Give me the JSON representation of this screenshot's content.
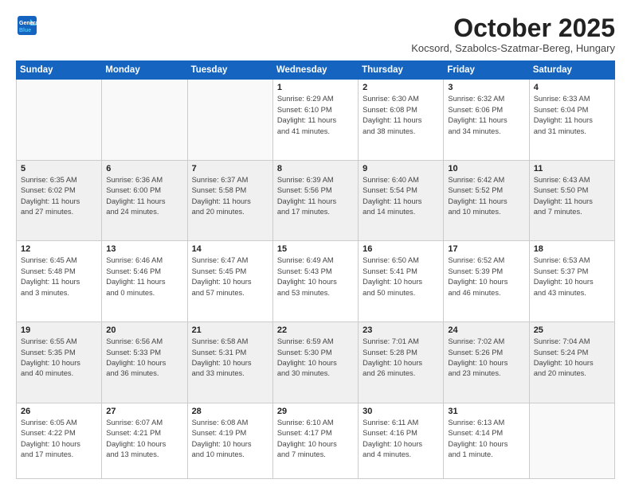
{
  "header": {
    "logo_line1": "General",
    "logo_line2": "Blue",
    "month": "October 2025",
    "location": "Kocsord, Szabolcs-Szatmar-Bereg, Hungary"
  },
  "weekdays": [
    "Sunday",
    "Monday",
    "Tuesday",
    "Wednesday",
    "Thursday",
    "Friday",
    "Saturday"
  ],
  "weeks": [
    [
      {
        "day": "",
        "info": ""
      },
      {
        "day": "",
        "info": ""
      },
      {
        "day": "",
        "info": ""
      },
      {
        "day": "1",
        "info": "Sunrise: 6:29 AM\nSunset: 6:10 PM\nDaylight: 11 hours\nand 41 minutes."
      },
      {
        "day": "2",
        "info": "Sunrise: 6:30 AM\nSunset: 6:08 PM\nDaylight: 11 hours\nand 38 minutes."
      },
      {
        "day": "3",
        "info": "Sunrise: 6:32 AM\nSunset: 6:06 PM\nDaylight: 11 hours\nand 34 minutes."
      },
      {
        "day": "4",
        "info": "Sunrise: 6:33 AM\nSunset: 6:04 PM\nDaylight: 11 hours\nand 31 minutes."
      }
    ],
    [
      {
        "day": "5",
        "info": "Sunrise: 6:35 AM\nSunset: 6:02 PM\nDaylight: 11 hours\nand 27 minutes."
      },
      {
        "day": "6",
        "info": "Sunrise: 6:36 AM\nSunset: 6:00 PM\nDaylight: 11 hours\nand 24 minutes."
      },
      {
        "day": "7",
        "info": "Sunrise: 6:37 AM\nSunset: 5:58 PM\nDaylight: 11 hours\nand 20 minutes."
      },
      {
        "day": "8",
        "info": "Sunrise: 6:39 AM\nSunset: 5:56 PM\nDaylight: 11 hours\nand 17 minutes."
      },
      {
        "day": "9",
        "info": "Sunrise: 6:40 AM\nSunset: 5:54 PM\nDaylight: 11 hours\nand 14 minutes."
      },
      {
        "day": "10",
        "info": "Sunrise: 6:42 AM\nSunset: 5:52 PM\nDaylight: 11 hours\nand 10 minutes."
      },
      {
        "day": "11",
        "info": "Sunrise: 6:43 AM\nSunset: 5:50 PM\nDaylight: 11 hours\nand 7 minutes."
      }
    ],
    [
      {
        "day": "12",
        "info": "Sunrise: 6:45 AM\nSunset: 5:48 PM\nDaylight: 11 hours\nand 3 minutes."
      },
      {
        "day": "13",
        "info": "Sunrise: 6:46 AM\nSunset: 5:46 PM\nDaylight: 11 hours\nand 0 minutes."
      },
      {
        "day": "14",
        "info": "Sunrise: 6:47 AM\nSunset: 5:45 PM\nDaylight: 10 hours\nand 57 minutes."
      },
      {
        "day": "15",
        "info": "Sunrise: 6:49 AM\nSunset: 5:43 PM\nDaylight: 10 hours\nand 53 minutes."
      },
      {
        "day": "16",
        "info": "Sunrise: 6:50 AM\nSunset: 5:41 PM\nDaylight: 10 hours\nand 50 minutes."
      },
      {
        "day": "17",
        "info": "Sunrise: 6:52 AM\nSunset: 5:39 PM\nDaylight: 10 hours\nand 46 minutes."
      },
      {
        "day": "18",
        "info": "Sunrise: 6:53 AM\nSunset: 5:37 PM\nDaylight: 10 hours\nand 43 minutes."
      }
    ],
    [
      {
        "day": "19",
        "info": "Sunrise: 6:55 AM\nSunset: 5:35 PM\nDaylight: 10 hours\nand 40 minutes."
      },
      {
        "day": "20",
        "info": "Sunrise: 6:56 AM\nSunset: 5:33 PM\nDaylight: 10 hours\nand 36 minutes."
      },
      {
        "day": "21",
        "info": "Sunrise: 6:58 AM\nSunset: 5:31 PM\nDaylight: 10 hours\nand 33 minutes."
      },
      {
        "day": "22",
        "info": "Sunrise: 6:59 AM\nSunset: 5:30 PM\nDaylight: 10 hours\nand 30 minutes."
      },
      {
        "day": "23",
        "info": "Sunrise: 7:01 AM\nSunset: 5:28 PM\nDaylight: 10 hours\nand 26 minutes."
      },
      {
        "day": "24",
        "info": "Sunrise: 7:02 AM\nSunset: 5:26 PM\nDaylight: 10 hours\nand 23 minutes."
      },
      {
        "day": "25",
        "info": "Sunrise: 7:04 AM\nSunset: 5:24 PM\nDaylight: 10 hours\nand 20 minutes."
      }
    ],
    [
      {
        "day": "26",
        "info": "Sunrise: 6:05 AM\nSunset: 4:22 PM\nDaylight: 10 hours\nand 17 minutes."
      },
      {
        "day": "27",
        "info": "Sunrise: 6:07 AM\nSunset: 4:21 PM\nDaylight: 10 hours\nand 13 minutes."
      },
      {
        "day": "28",
        "info": "Sunrise: 6:08 AM\nSunset: 4:19 PM\nDaylight: 10 hours\nand 10 minutes."
      },
      {
        "day": "29",
        "info": "Sunrise: 6:10 AM\nSunset: 4:17 PM\nDaylight: 10 hours\nand 7 minutes."
      },
      {
        "day": "30",
        "info": "Sunrise: 6:11 AM\nSunset: 4:16 PM\nDaylight: 10 hours\nand 4 minutes."
      },
      {
        "day": "31",
        "info": "Sunrise: 6:13 AM\nSunset: 4:14 PM\nDaylight: 10 hours\nand 1 minute."
      },
      {
        "day": "",
        "info": ""
      }
    ]
  ]
}
